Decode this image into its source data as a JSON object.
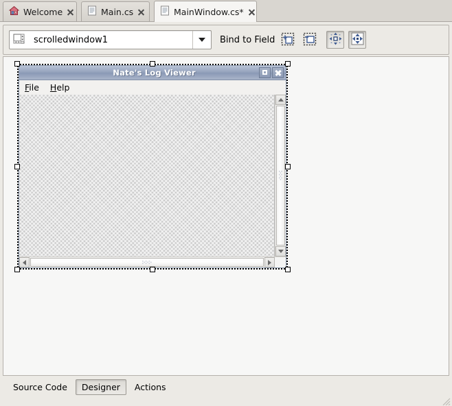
{
  "window": {
    "editor_tabs": [
      {
        "label": "Welcome",
        "icon": "home-icon",
        "active": false,
        "closable": true
      },
      {
        "label": "Main.cs",
        "icon": "document-icon",
        "active": false,
        "closable": true
      },
      {
        "label": "MainWindow.cs*",
        "icon": "document-icon",
        "active": true,
        "closable": true
      }
    ]
  },
  "toolbar": {
    "widget_selector": {
      "value": "scrolledwindow1",
      "placeholder": "scrolledwindow1",
      "icon": "scrolledwindow-icon",
      "dropdown_icon": "chevron-down-icon"
    },
    "bind_to_field_label": "Bind to Field",
    "buttons": [
      {
        "name": "add-widget-button",
        "icon": "add-box-icon",
        "pressed": false
      },
      {
        "name": "insert-widget-button",
        "icon": "insert-box-icon",
        "pressed": false
      },
      {
        "name": "move-widget-button",
        "icon": "move-arrows-icon",
        "pressed": true
      },
      {
        "name": "resize-widget-button",
        "icon": "resize-diamond-icon",
        "pressed": true
      }
    ]
  },
  "designer": {
    "selected_widget": "scrolledwindow1",
    "mock_window": {
      "title": "Nate's Log Viewer",
      "titlebar_buttons": [
        {
          "name": "maximize-button",
          "icon": "maximize-icon"
        },
        {
          "name": "close-button",
          "icon": "close-icon"
        }
      ],
      "menubar": [
        {
          "label": "File",
          "accel": "F"
        },
        {
          "label": "Help",
          "accel": "H"
        }
      ]
    },
    "scrollbars": {
      "vertical": {
        "up_icon": "triangle-up-icon",
        "down_icon": "triangle-down-icon",
        "grip": "grip-icon"
      },
      "horizontal": {
        "left_icon": "triangle-left-icon",
        "right_icon": "triangle-right-icon",
        "grip": "grip-icon"
      }
    }
  },
  "view_tabs": [
    {
      "label": "Source Code",
      "active": false
    },
    {
      "label": "Designer",
      "active": true
    },
    {
      "label": "Actions",
      "active": false
    }
  ],
  "colors": {
    "chrome": "#eceae5",
    "canvas": "#f7f7f6",
    "titlebar_start": "#b9c3d6",
    "titlebar_end": "#8a99b6",
    "accent_blue": "#3f5c93",
    "home_icon_red": "#c94a5a",
    "selection_handle": "#ffffff"
  }
}
